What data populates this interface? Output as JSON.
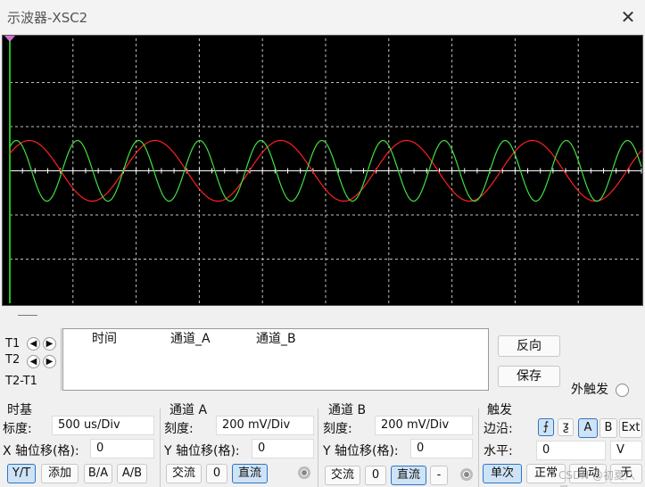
{
  "window": {
    "title": "示波器-XSC2"
  },
  "colors": {
    "channel_a": "#ff2020",
    "channel_b": "#40e040",
    "screen_bg": "#000000",
    "grid": "#bfbfbf",
    "cursor_line": "#22c022"
  },
  "cursors": {
    "t1": "T1",
    "t2": "T2",
    "t2_t1": "T2-T1"
  },
  "readout": {
    "columns": [
      "时间",
      "通道_A",
      "通道_B"
    ]
  },
  "buttons": {
    "reverse": "反向",
    "save": "保存"
  },
  "external_trigger": {
    "label": "外触发"
  },
  "timebase": {
    "title": "时基",
    "scale_label": "标度:",
    "scale_value": "500 us/Div",
    "x_offset_label": "X 轴位移(格):",
    "x_offset_value": "0",
    "modes": [
      "Y/T",
      "添加",
      "B/A",
      "A/B"
    ],
    "active_mode": "Y/T"
  },
  "channel_a": {
    "title": "通道 A",
    "scale_label": "刻度:",
    "scale_value": "200 mV/Div",
    "y_offset_label": "Y 轴位移(格):",
    "y_offset_value": "0",
    "coupling": [
      "交流",
      "0",
      "直流"
    ],
    "active_coupling": "直流"
  },
  "channel_b": {
    "title": "通道 B",
    "scale_label": "刻度:",
    "scale_value": "200 mV/Div",
    "y_offset_label": "Y 轴位移(格):",
    "y_offset_value": "0",
    "coupling": [
      "交流",
      "0",
      "直流",
      "-"
    ],
    "active_coupling": "直流"
  },
  "trigger": {
    "title": "触发",
    "edge_label": "边沿:",
    "edge_rising": "⨍",
    "edge_falling": "ƺ",
    "sources": [
      "A",
      "B",
      "Ext"
    ],
    "active_source": "A",
    "level_label": "水平:",
    "level_value": "0",
    "level_unit": "V",
    "modes": [
      "单次",
      "正常",
      "自动",
      "无"
    ],
    "active_mode": "单次"
  },
  "watermark": "CSDN @初夏八月"
}
